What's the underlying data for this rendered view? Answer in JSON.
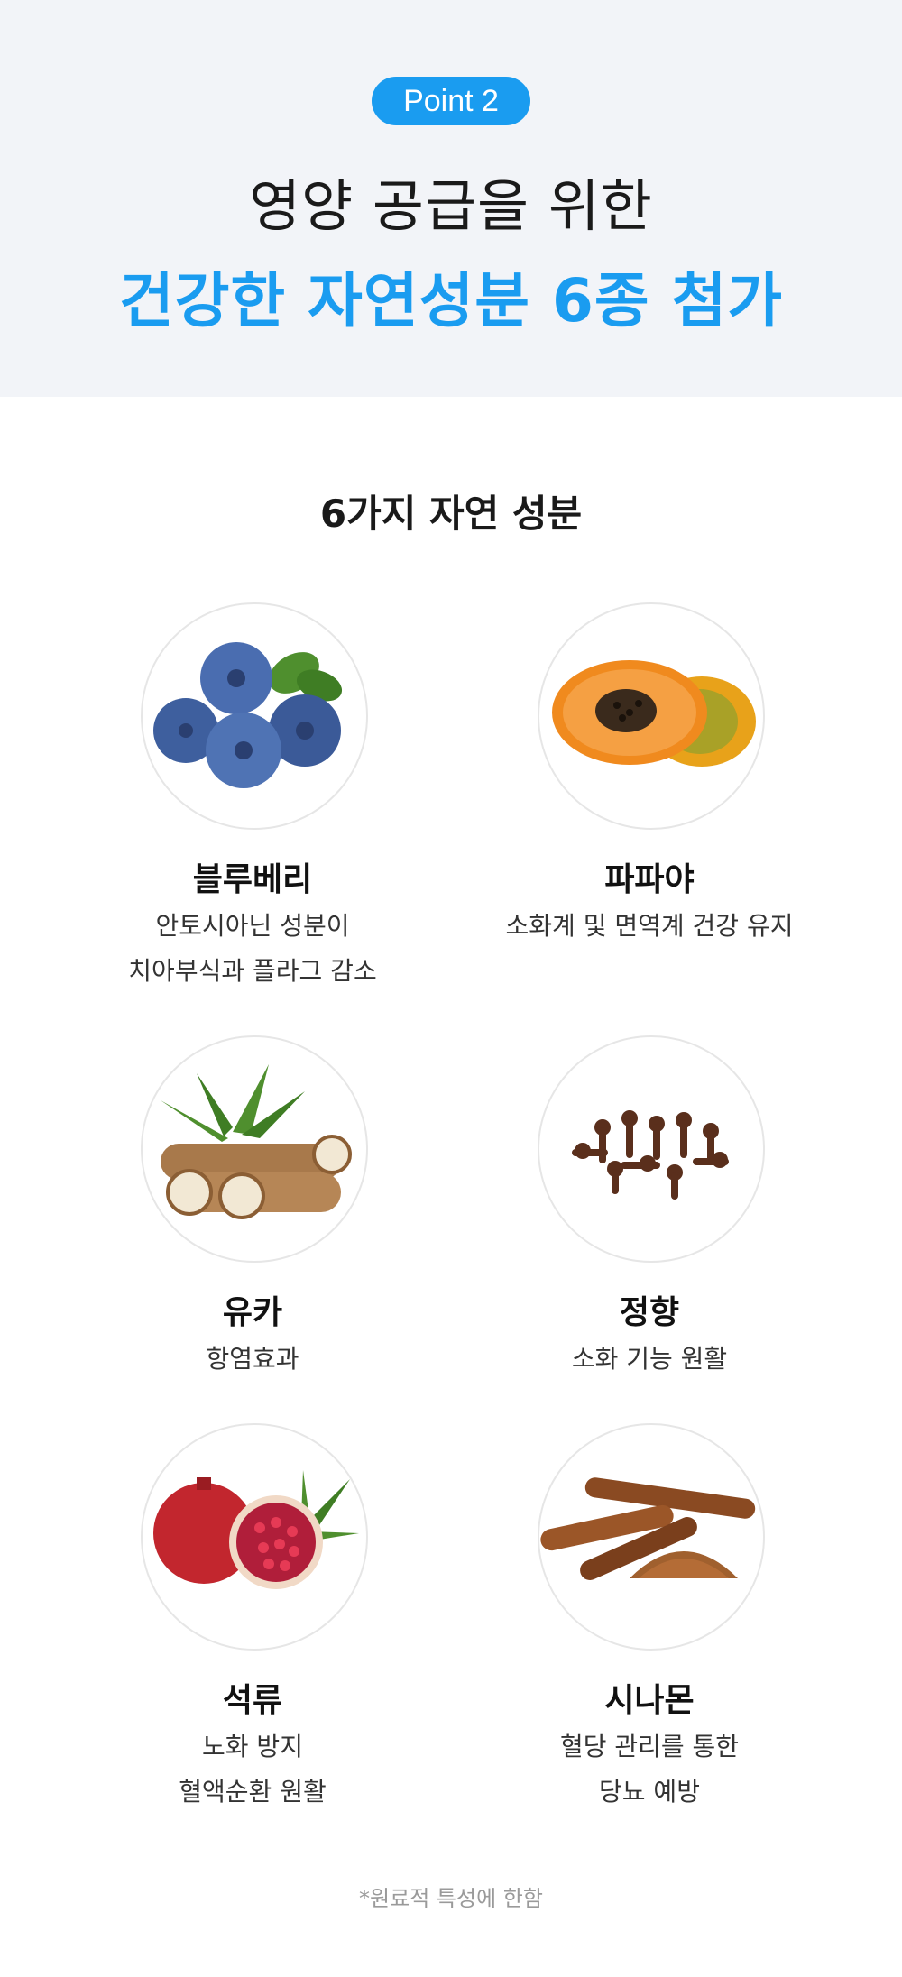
{
  "header": {
    "badge": "Point 2",
    "title_line1": "영양 공급을 위한",
    "title_line2": "건강한 자연성분 6종 첨가"
  },
  "section_title": "6가지 자연 성분",
  "ingredients": [
    {
      "name": "블루베리",
      "desc1": "안토시아닌 성분이",
      "desc2": "치아부식과 플라그 감소",
      "icon": "blueberry-icon"
    },
    {
      "name": "파파야",
      "desc1": "소화계 및 면역계 건강 유지",
      "desc2": "",
      "icon": "papaya-icon"
    },
    {
      "name": "유카",
      "desc1": "항염효과",
      "desc2": "",
      "icon": "yucca-icon"
    },
    {
      "name": "정향",
      "desc1": "소화 기능 원활",
      "desc2": "",
      "icon": "clove-icon"
    },
    {
      "name": "석류",
      "desc1": "노화 방지",
      "desc2": "혈액순환 원활",
      "icon": "pomegranate-icon"
    },
    {
      "name": "시나몬",
      "desc1": "혈당 관리를 통한",
      "desc2": "당뇨 예방",
      "icon": "cinnamon-icon"
    }
  ],
  "footnote": "*원료적 특성에 한함",
  "colors": {
    "accent": "#1a9cf0",
    "hero_bg": "#f2f4f8",
    "text": "#111111",
    "muted": "#9a9a9a"
  }
}
